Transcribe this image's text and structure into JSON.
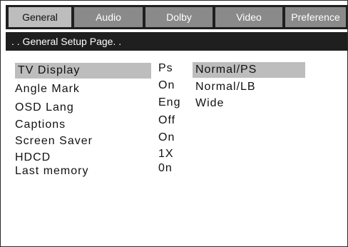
{
  "tabs": [
    {
      "label": "General",
      "active": true
    },
    {
      "label": "Audio",
      "active": false
    },
    {
      "label": "Dolby",
      "active": false
    },
    {
      "label": "Video",
      "active": false
    },
    {
      "label": "Preference",
      "active": false
    }
  ],
  "page_title": ". . General Setup Page. .",
  "settings": [
    {
      "label": "TV Display",
      "value": "Ps"
    },
    {
      "label": "Angle Mark",
      "value": "On"
    },
    {
      "label": "OSD Lang",
      "value": "Eng"
    },
    {
      "label": "Captions",
      "value": "Off"
    },
    {
      "label": "Screen Saver",
      "value": "On"
    },
    {
      "label": "HDCD",
      "value": "1X"
    },
    {
      "label": "Last memory",
      "value": "0n"
    }
  ],
  "options": [
    "Normal/PS",
    "Normal/LB",
    "Wide"
  ],
  "colors": {
    "bar_background": "#1f1f1f",
    "tab_inactive": "#8a8a8a",
    "tab_active": "#bdbdbd",
    "highlight": "#bdbdbd"
  }
}
